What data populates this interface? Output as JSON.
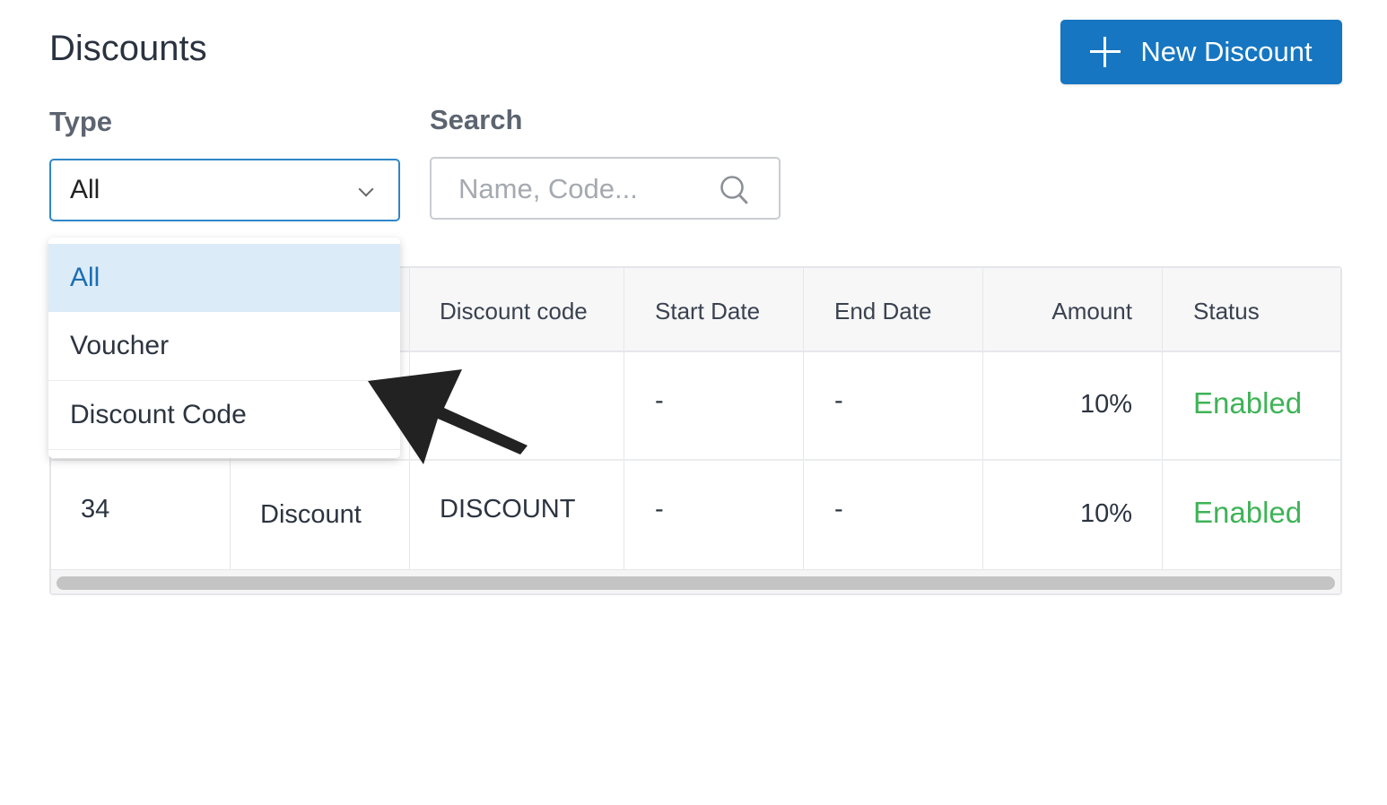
{
  "header": {
    "title": "Discounts",
    "new_button_label": "New Discount"
  },
  "filters": {
    "type_label": "Type",
    "type_selected": "All",
    "search_label": "Search",
    "search_placeholder": "Name, Code..."
  },
  "dropdown": {
    "options": [
      "All",
      "Voucher",
      "Discount Code"
    ],
    "selected_index": 0
  },
  "table": {
    "columns": [
      "Discount code",
      "Start Date",
      "End Date",
      "Amount",
      "Status"
    ],
    "rows": [
      {
        "id": "",
        "type": "",
        "code": "",
        "start": "-",
        "end": "-",
        "amount": "10%",
        "status": "Enabled"
      },
      {
        "id": "34",
        "type": "Discount",
        "code": "DISCOUNT",
        "start": "-",
        "end": "-",
        "amount": "10%",
        "status": "Enabled"
      }
    ]
  },
  "colors": {
    "accent": "#1676c1",
    "status_enabled": "#3fb357",
    "selected_option_bg": "#dcebf8"
  },
  "icons": [
    "plus-icon",
    "chevron-down-icon",
    "search-icon",
    "pointer-arrow-icon"
  ]
}
